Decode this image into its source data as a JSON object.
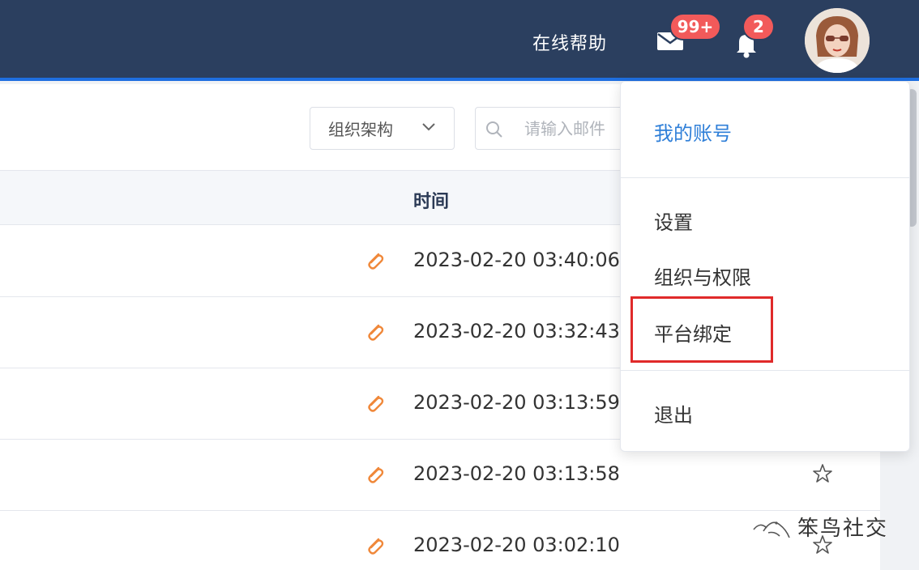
{
  "header": {
    "help_label": "在线帮助",
    "mail_badge": "99+",
    "bell_badge": "2"
  },
  "toolbar": {
    "org_select_value": "组织架构",
    "search_placeholder": "请输入邮件"
  },
  "table": {
    "time_header": "时间",
    "rows": [
      {
        "time": "2023-02-20 03:40:06"
      },
      {
        "time": "2023-02-20 03:32:43"
      },
      {
        "time": "2023-02-20 03:13:59"
      },
      {
        "time": "2023-02-20 03:13:58"
      },
      {
        "time": "2023-02-20 03:02:10"
      }
    ]
  },
  "dropdown": {
    "my_account": "我的账号",
    "settings": "设置",
    "org_permissions": "组织与权限",
    "platform_binding": "平台绑定",
    "logout": "退出"
  },
  "watermark": {
    "text": "笨鸟社交"
  },
  "colors": {
    "header_bg": "#2b3f5f",
    "accent_blue": "#2f7fd8",
    "badge_red": "#f25a5a",
    "highlight_red": "#e02a2a",
    "clip_orange": "#f0883a"
  },
  "icons": {
    "mail": "mail-icon",
    "bell": "bell-icon",
    "search": "search-icon",
    "chevron": "chevron-down-icon",
    "clip": "paperclip-icon",
    "star": "star-icon"
  }
}
